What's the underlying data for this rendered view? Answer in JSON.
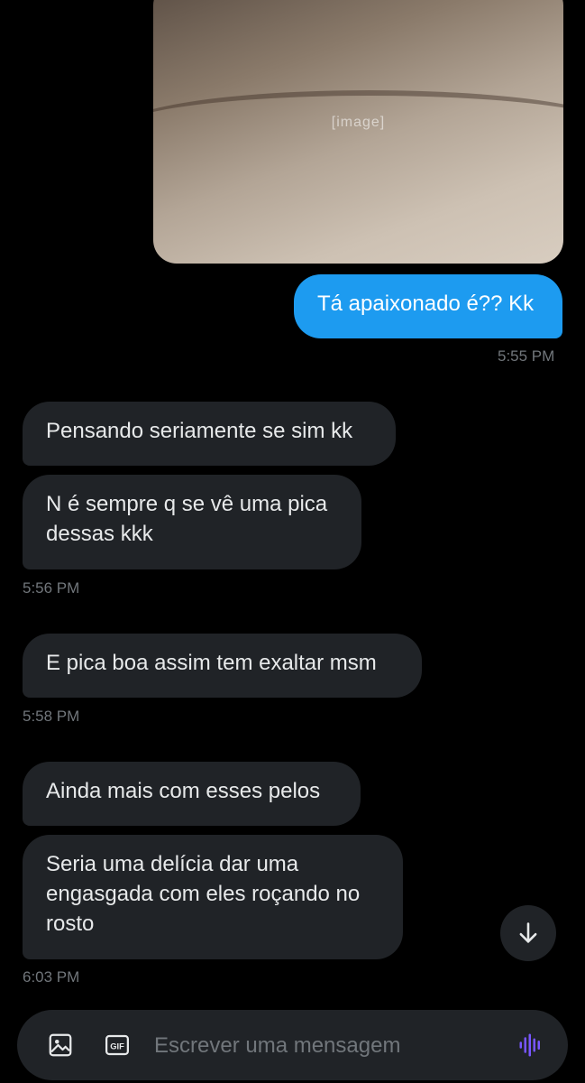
{
  "conversation": {
    "media_caption": "[image]",
    "messages": [
      {
        "direction": "sent",
        "text": "Tá apaixonado é?? Kk"
      },
      {
        "direction": "received",
        "text": "Pensando seriamente se sim kk"
      },
      {
        "direction": "received",
        "text": "N é sempre q se vê uma pica\ndessas kkk"
      },
      {
        "direction": "received",
        "text": "E pica boa assim tem exaltar msm"
      },
      {
        "direction": "received",
        "text": "Ainda mais com esses pelos"
      },
      {
        "direction": "received",
        "text": "Seria uma delícia dar uma\nengasgada com eles roçando no\nrosto"
      }
    ],
    "timestamps": [
      "5:55 PM",
      "5:56 PM",
      "5:58 PM",
      "6:03 PM"
    ]
  },
  "composer": {
    "placeholder": "Escrever uma mensagem",
    "value": "",
    "gif_label": "GIF"
  },
  "icons": {
    "image": "image-icon",
    "gif": "gif-icon",
    "voice": "voice-waveform-icon",
    "scroll": "arrow-down-icon"
  },
  "colors": {
    "background": "#000000",
    "sent_bubble": "#1d9bf0",
    "received_bubble": "#202327",
    "timestamp": "#71767b",
    "voice_accent": "#7856ff"
  }
}
